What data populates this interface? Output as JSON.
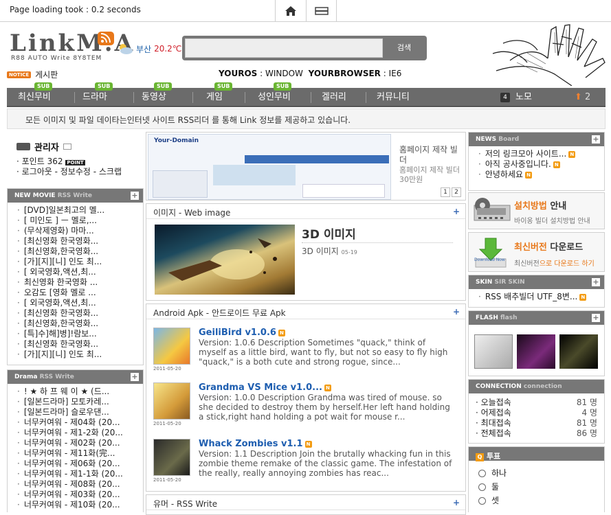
{
  "top": {
    "load_time": "Page loading took : 0.2 seconds"
  },
  "header": {
    "logo_text": "LinkM.A",
    "logo_sub": "R88 AUTO Write 8Y8TEM",
    "weather_city": "부산",
    "weather_temp": "20.2℃",
    "search_placeholder": "",
    "search_button": "검색",
    "notice_tag": "NOTICE",
    "notice_label": "게시판",
    "os_label": "YOUROS",
    "os_value": ": WINDOW",
    "browser_label": "YOURBROWSER",
    "browser_value": ": IE6"
  },
  "nav": {
    "items": [
      "최신무비",
      "드라마",
      "동영상",
      "게임",
      "성인무비",
      "겔러리",
      "커뮤니티"
    ],
    "sub_tag": "SUB",
    "memo_count": "4",
    "memo_label": "노모",
    "up_count": "2"
  },
  "info": "모든 이미지 및 파일 데이타는인터넷 사이트 RSS리더 를 통해 Link 정보를 제공하고 있습니다.",
  "admin": {
    "title": "관리자",
    "point_label": "포인트 362",
    "point_tag": "POINT",
    "links": "로그아웃 - 정보수정 - 스크랩"
  },
  "new_movie": {
    "title": "NEW MOVIE",
    "title_dim": "RSS Write",
    "items": [
      "[DVD]일본최고의 멜...",
      "[ 미인도 ] ㅡ 멜로,...",
      "(무삭제영화) 마마...",
      "[최신영화 한국영화...",
      "[최신영화,한국영화...",
      "[가][지][니] 인도 최...",
      "[ 외국영화,액션,최...",
      "최신영화 한국영화 ...",
      "오감도 [영화 멜로 ...",
      "[ 외국영화,액션,최...",
      "[최신영화 한국영화...",
      "[최신영화,한국영화...",
      "[특]수]해]병]!람보...",
      "[최신영화 한국영화...",
      "[가][지][니] 인도 최..."
    ]
  },
  "drama": {
    "title": "Drama",
    "title_dim": "RSS Write",
    "items": [
      "! ★ 하 프 웨 이 ★ (드...",
      "[일본드라마] 모토카레...",
      "[일본드라마] 슬로우댄...",
      "너무커여워 - 제04화 (20...",
      "너무커여워 - 제1-2화 (20...",
      "너무커여워 - 제02화 (20...",
      "너무커여워 - 제11화(完...",
      "너무커여워 - 제06화 (20...",
      "너무커여워 - 제1-1화 (20...",
      "너무커여워 - 제08화 (20...",
      "너무커여워 - 제03화 (20...",
      "너무커여워 - 제10화 (20..."
    ]
  },
  "banner": {
    "title": "홈페이지 제작 빌더",
    "desc": "홈페이지 제작 빌더 30만원",
    "page1": "1",
    "page2": "2",
    "site_name": "Your-Domain"
  },
  "web_image": {
    "head": "이미지 - Web image",
    "title": "3D 이미지",
    "sub": "3D 이미지",
    "date": "05-19"
  },
  "apk": {
    "head": "Android  Apk  - 안드로이드 무료 Apk",
    "items": [
      {
        "title": "GeiliBird v1.0.6",
        "desc": "Version: 1.0.6 Description Sometimes \"quack,\" think of myself as a little bird, want to fly, but not so easy to fly high \"quack,\" is a both cute and strong rogue, since...",
        "date": "2011-05-20"
      },
      {
        "title": "Grandma VS Mice v1.0...",
        "desc": "Version: 1.0.0 Description Grandma was tired of mouse. so she decided to destroy them by herself.Her left hand holding a stick,right hand holding a pot wait for mouse r...",
        "date": "2011-05-20"
      },
      {
        "title": "Whack Zombies v1.1",
        "desc": "Version: 1.1 Description Join the brutally whacking fun in this zombie theme remake of the classic game. The infestation of the really, really annoying zombies has reac...",
        "date": "2011-05-20"
      }
    ]
  },
  "humor": {
    "head": "유머 - RSS Write"
  },
  "news": {
    "title": "NEWS",
    "title_dim": "Board",
    "items": [
      "저의 링크모아 사이트...",
      "아직 공사중입니다.",
      "안녕하세요"
    ]
  },
  "install": {
    "title_a": "설치방법",
    "title_b": "안내",
    "desc": "바이옹 빌더 설치방법 안내"
  },
  "latest": {
    "title_a": "최신버전",
    "title_b": "다운로드",
    "desc_a": "최신버전",
    "desc_b": "으로 다운로드 하기",
    "icon_label": "Download Now"
  },
  "skin": {
    "title": "SKIN",
    "title_dim": "SIR SKIN",
    "item": "RSS 배추빌더 UTF_8변..."
  },
  "flash": {
    "title": "FLASH",
    "title_dim": "flash"
  },
  "connection": {
    "title": "CONNECTION",
    "title_dim": "connection",
    "rows": [
      {
        "label": "오늘접속",
        "value": "81 명"
      },
      {
        "label": "어제접속",
        "value": "4 명"
      },
      {
        "label": "최대접속",
        "value": "81 명"
      },
      {
        "label": "전체접속",
        "value": "86 명"
      }
    ]
  },
  "vote": {
    "title": "투표",
    "options": [
      "하나",
      "둘",
      "셋"
    ]
  },
  "colors": {
    "accent_orange": "#e8781a",
    "nav_gray": "#6b6b6b",
    "link_blue": "#1e5eb0"
  }
}
